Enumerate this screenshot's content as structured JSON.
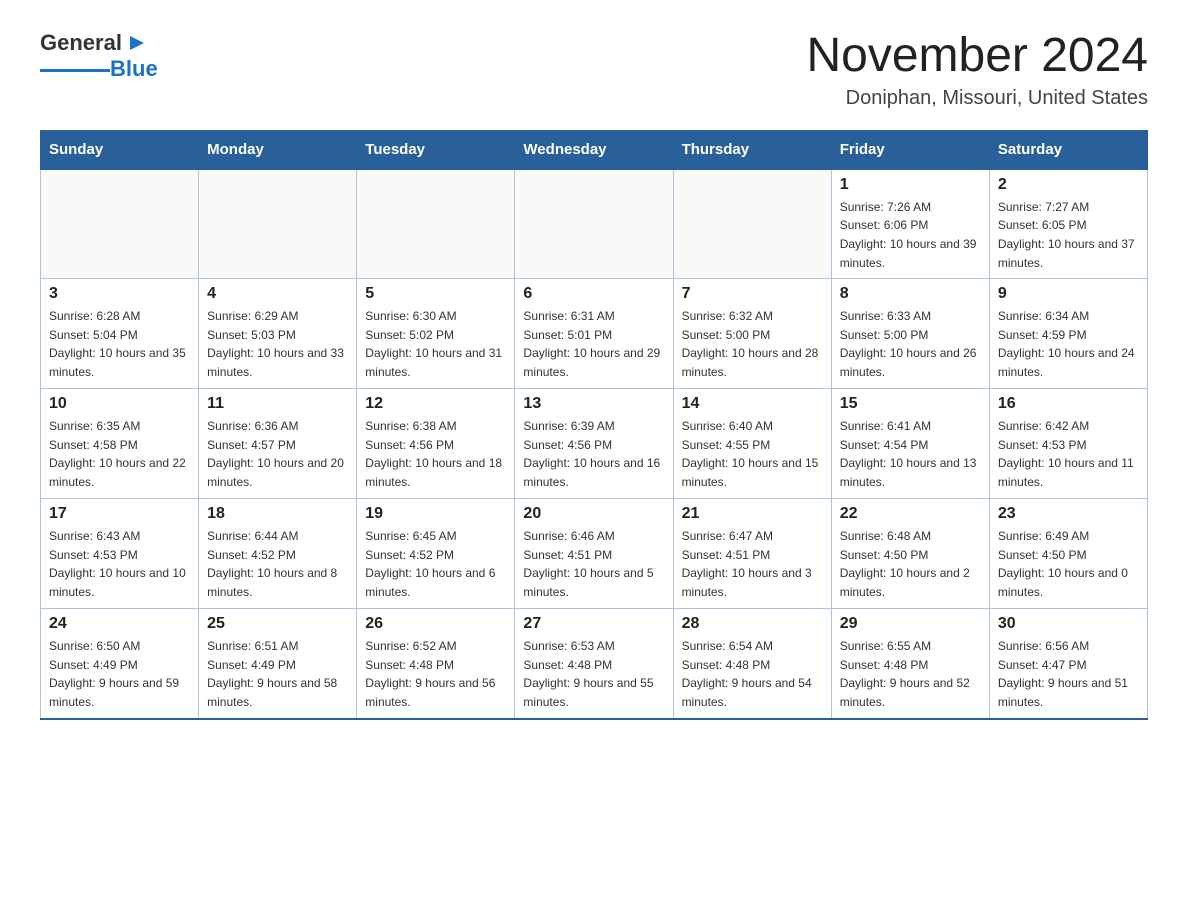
{
  "header": {
    "logo_name": "General",
    "logo_accent": "Blue",
    "month_title": "November 2024",
    "location": "Doniphan, Missouri, United States"
  },
  "weekdays": [
    "Sunday",
    "Monday",
    "Tuesday",
    "Wednesday",
    "Thursday",
    "Friday",
    "Saturday"
  ],
  "weeks": [
    [
      {
        "day": "",
        "info": ""
      },
      {
        "day": "",
        "info": ""
      },
      {
        "day": "",
        "info": ""
      },
      {
        "day": "",
        "info": ""
      },
      {
        "day": "",
        "info": ""
      },
      {
        "day": "1",
        "info": "Sunrise: 7:26 AM\nSunset: 6:06 PM\nDaylight: 10 hours and 39 minutes."
      },
      {
        "day": "2",
        "info": "Sunrise: 7:27 AM\nSunset: 6:05 PM\nDaylight: 10 hours and 37 minutes."
      }
    ],
    [
      {
        "day": "3",
        "info": "Sunrise: 6:28 AM\nSunset: 5:04 PM\nDaylight: 10 hours and 35 minutes."
      },
      {
        "day": "4",
        "info": "Sunrise: 6:29 AM\nSunset: 5:03 PM\nDaylight: 10 hours and 33 minutes."
      },
      {
        "day": "5",
        "info": "Sunrise: 6:30 AM\nSunset: 5:02 PM\nDaylight: 10 hours and 31 minutes."
      },
      {
        "day": "6",
        "info": "Sunrise: 6:31 AM\nSunset: 5:01 PM\nDaylight: 10 hours and 29 minutes."
      },
      {
        "day": "7",
        "info": "Sunrise: 6:32 AM\nSunset: 5:00 PM\nDaylight: 10 hours and 28 minutes."
      },
      {
        "day": "8",
        "info": "Sunrise: 6:33 AM\nSunset: 5:00 PM\nDaylight: 10 hours and 26 minutes."
      },
      {
        "day": "9",
        "info": "Sunrise: 6:34 AM\nSunset: 4:59 PM\nDaylight: 10 hours and 24 minutes."
      }
    ],
    [
      {
        "day": "10",
        "info": "Sunrise: 6:35 AM\nSunset: 4:58 PM\nDaylight: 10 hours and 22 minutes."
      },
      {
        "day": "11",
        "info": "Sunrise: 6:36 AM\nSunset: 4:57 PM\nDaylight: 10 hours and 20 minutes."
      },
      {
        "day": "12",
        "info": "Sunrise: 6:38 AM\nSunset: 4:56 PM\nDaylight: 10 hours and 18 minutes."
      },
      {
        "day": "13",
        "info": "Sunrise: 6:39 AM\nSunset: 4:56 PM\nDaylight: 10 hours and 16 minutes."
      },
      {
        "day": "14",
        "info": "Sunrise: 6:40 AM\nSunset: 4:55 PM\nDaylight: 10 hours and 15 minutes."
      },
      {
        "day": "15",
        "info": "Sunrise: 6:41 AM\nSunset: 4:54 PM\nDaylight: 10 hours and 13 minutes."
      },
      {
        "day": "16",
        "info": "Sunrise: 6:42 AM\nSunset: 4:53 PM\nDaylight: 10 hours and 11 minutes."
      }
    ],
    [
      {
        "day": "17",
        "info": "Sunrise: 6:43 AM\nSunset: 4:53 PM\nDaylight: 10 hours and 10 minutes."
      },
      {
        "day": "18",
        "info": "Sunrise: 6:44 AM\nSunset: 4:52 PM\nDaylight: 10 hours and 8 minutes."
      },
      {
        "day": "19",
        "info": "Sunrise: 6:45 AM\nSunset: 4:52 PM\nDaylight: 10 hours and 6 minutes."
      },
      {
        "day": "20",
        "info": "Sunrise: 6:46 AM\nSunset: 4:51 PM\nDaylight: 10 hours and 5 minutes."
      },
      {
        "day": "21",
        "info": "Sunrise: 6:47 AM\nSunset: 4:51 PM\nDaylight: 10 hours and 3 minutes."
      },
      {
        "day": "22",
        "info": "Sunrise: 6:48 AM\nSunset: 4:50 PM\nDaylight: 10 hours and 2 minutes."
      },
      {
        "day": "23",
        "info": "Sunrise: 6:49 AM\nSunset: 4:50 PM\nDaylight: 10 hours and 0 minutes."
      }
    ],
    [
      {
        "day": "24",
        "info": "Sunrise: 6:50 AM\nSunset: 4:49 PM\nDaylight: 9 hours and 59 minutes."
      },
      {
        "day": "25",
        "info": "Sunrise: 6:51 AM\nSunset: 4:49 PM\nDaylight: 9 hours and 58 minutes."
      },
      {
        "day": "26",
        "info": "Sunrise: 6:52 AM\nSunset: 4:48 PM\nDaylight: 9 hours and 56 minutes."
      },
      {
        "day": "27",
        "info": "Sunrise: 6:53 AM\nSunset: 4:48 PM\nDaylight: 9 hours and 55 minutes."
      },
      {
        "day": "28",
        "info": "Sunrise: 6:54 AM\nSunset: 4:48 PM\nDaylight: 9 hours and 54 minutes."
      },
      {
        "day": "29",
        "info": "Sunrise: 6:55 AM\nSunset: 4:48 PM\nDaylight: 9 hours and 52 minutes."
      },
      {
        "day": "30",
        "info": "Sunrise: 6:56 AM\nSunset: 4:47 PM\nDaylight: 9 hours and 51 minutes."
      }
    ]
  ]
}
